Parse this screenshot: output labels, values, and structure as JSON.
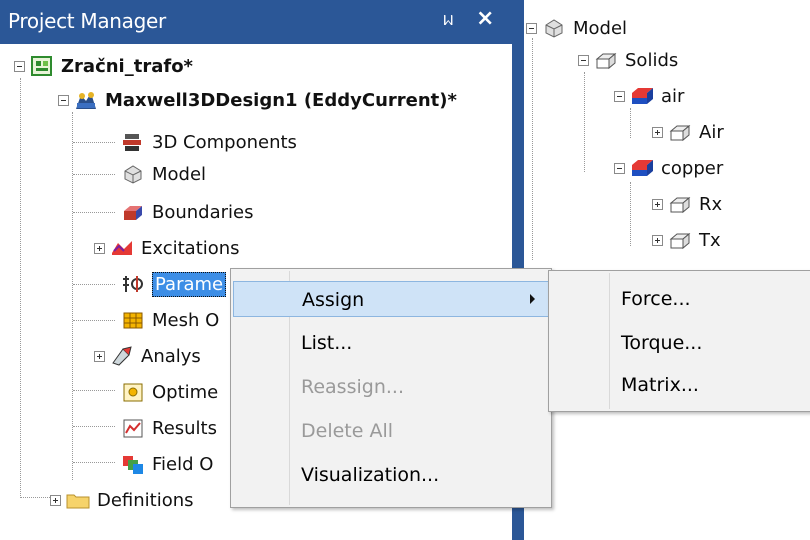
{
  "project_manager": {
    "title": "Project Manager",
    "pin_glyph": "ᥕ",
    "close_glyph": "×",
    "project_name": "Zračni_trafo*",
    "design_name": "Maxwell3DDesign1 (EddyCurrent)*",
    "design_items": [
      {
        "label": "3D Components",
        "icon": "components-icon"
      },
      {
        "label": "Model",
        "icon": "model-icon"
      },
      {
        "label": "Boundaries",
        "icon": "boundaries-icon"
      },
      {
        "label": "Excitations",
        "icon": "excitations-icon"
      },
      {
        "label": "Parame",
        "icon": "parameters-icon"
      },
      {
        "label": "Mesh O",
        "icon": "mesh-icon"
      },
      {
        "label": "Analys",
        "icon": "analysis-icon"
      },
      {
        "label": "Optime",
        "icon": "optimetrics-icon"
      },
      {
        "label": "Results",
        "icon": "results-icon"
      },
      {
        "label": "Field O",
        "icon": "field-overlays-icon"
      }
    ],
    "definitions_label": "Definitions"
  },
  "model_tree": {
    "root": "Model",
    "solids": "Solids",
    "air_material": "air",
    "air_object": "Air",
    "copper_material": "copper",
    "rx": "Rx",
    "tx": "Tx"
  },
  "context_menu": {
    "items": [
      {
        "label": "Assign",
        "enabled": true,
        "highlighted": true,
        "has_submenu": true
      },
      {
        "label": "List...",
        "enabled": true
      },
      {
        "label": "Reassign...",
        "enabled": false
      },
      {
        "label": "Delete All",
        "enabled": false
      },
      {
        "label": "Visualization...",
        "enabled": true
      }
    ]
  },
  "submenu": {
    "items": [
      {
        "label": "Force..."
      },
      {
        "label": "Torque..."
      },
      {
        "label": "Matrix..."
      }
    ]
  },
  "colors": {
    "header_bg": "#2b5797",
    "selection_bg": "#3d8ee6",
    "menu_bg": "#f2f2f2",
    "menu_highlight": "#cfe3f7",
    "disabled_text": "#9a9a9a"
  }
}
